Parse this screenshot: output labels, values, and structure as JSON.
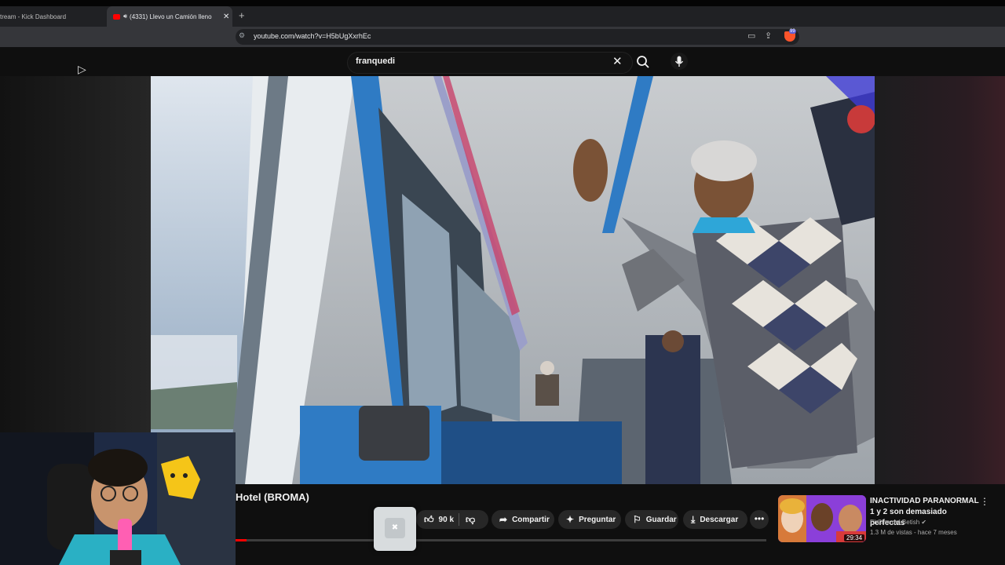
{
  "browser": {
    "tabs": [
      {
        "title": "tream - Kick Dashboard",
        "active": false
      },
      {
        "title": "(4331) Llevo un Camión lleno",
        "active": true
      }
    ],
    "new_tab_glyph": "+",
    "close_glyph": "✕",
    "url": "youtube.com/watch?v=H5bUgXxrhEc",
    "brave_badge": "99"
  },
  "search": {
    "query": "franquedi",
    "clear_glyph": "✕"
  },
  "video": {
    "title_visible": "Hotel (BROMA)",
    "progress_fraction": 0.02
  },
  "actions": {
    "likes": "90 k",
    "share": "Compartir",
    "ask": "Preguntar",
    "save": "Guardar",
    "download": "Descargar",
    "more_glyph": "•••"
  },
  "recommended": {
    "title": "INACTIVIDAD PARANORMAL 1 y 2 son demasiado perfectas",
    "channel": "El Cine del Betish",
    "meta": "1.3 M de vistas - hace 7 meses",
    "duration": "29:34"
  },
  "icons": {
    "favicon": "youtube-favicon",
    "speaker": "speaker-icon",
    "like": "thumbs-up-icon",
    "dislike": "thumbs-down-icon",
    "share": "share-arrow-icon",
    "ask": "sparkle-icon",
    "save": "bookmark-icon",
    "download": "download-icon",
    "search": "search-icon",
    "mic": "mic-icon"
  },
  "colors": {
    "youtube_red": "#ff0000",
    "page_bg": "#0f0f0f",
    "pill_bg": "#272727"
  }
}
